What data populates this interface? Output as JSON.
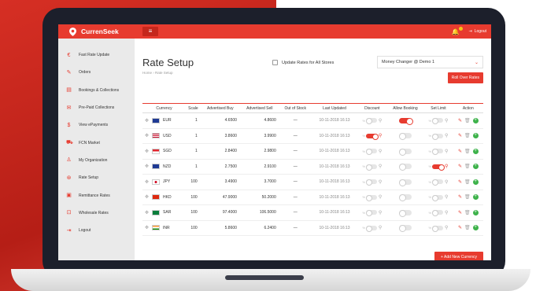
{
  "app": {
    "brand": "CurrenSeek",
    "menu_icon": "hamburger-icon",
    "logout_label": "Logout"
  },
  "sidebar": {
    "items": [
      {
        "label": "Fast Rate Update",
        "icon": "exchange-icon"
      },
      {
        "label": "Orders",
        "icon": "pencil-icon"
      },
      {
        "label": "Bookings & Collections",
        "icon": "document-icon"
      },
      {
        "label": "Pre-Paid Collections",
        "icon": "envelope-icon"
      },
      {
        "label": "View ePayments",
        "icon": "dollar-icon"
      },
      {
        "label": "FCN Market",
        "icon": "cart-icon"
      },
      {
        "label": "My Organization",
        "icon": "user-icon"
      },
      {
        "label": "Rate Setup",
        "icon": "rate-icon"
      },
      {
        "label": "Remittance Rates",
        "icon": "remittance-icon"
      },
      {
        "label": "Wholesale Rates",
        "icon": "wholesale-icon"
      },
      {
        "label": "Logout",
        "icon": "logout-icon"
      }
    ]
  },
  "page": {
    "title": "Rate Setup",
    "breadcrumb_home": "Home",
    "breadcrumb_sep": "›",
    "breadcrumb_current": "Rate Setup",
    "update_all_label": "Update Rates for All Stores",
    "store_select": "Money Changer @ Demo 1",
    "rollover_label": "Roll Over Rates",
    "add_currency_label": "+ Add New Currency"
  },
  "table": {
    "headers": [
      "Currency",
      "Scale",
      "Advertised Buy",
      "Advertised Sell",
      "Out of Stock",
      "Last Updated",
      "Discount",
      "Allow Booking",
      "Set Limit",
      "Action"
    ],
    "rows": [
      {
        "code": "EUR",
        "flag": "eu",
        "scale": "1",
        "buy": "4.6500",
        "sell": "4.8600",
        "stock": "—",
        "updated": "10-11-2018 16:13",
        "discount": false,
        "booking": true,
        "limit": false
      },
      {
        "code": "USD",
        "flag": "us",
        "scale": "1",
        "buy": "3.8600",
        "sell": "3.9900",
        "stock": "—",
        "updated": "10-11-2018 16:13",
        "discount": true,
        "booking": false,
        "limit": false
      },
      {
        "code": "SGD",
        "flag": "sg",
        "scale": "1",
        "buy": "2.8400",
        "sell": "2.9800",
        "stock": "—",
        "updated": "10-11-2018 16:13",
        "discount": false,
        "booking": false,
        "limit": false
      },
      {
        "code": "NZD",
        "flag": "nz",
        "scale": "1",
        "buy": "2.7500",
        "sell": "2.9100",
        "stock": "—",
        "updated": "10-11-2018 16:13",
        "discount": false,
        "booking": false,
        "limit": true
      },
      {
        "code": "JPY",
        "flag": "jp",
        "scale": "100",
        "buy": "3.4900",
        "sell": "3.7000",
        "stock": "—",
        "updated": "10-11-2018 16:13",
        "discount": false,
        "booking": false,
        "limit": false
      },
      {
        "code": "HKD",
        "flag": "hk",
        "scale": "100",
        "buy": "47.9000",
        "sell": "50.2000",
        "stock": "—",
        "updated": "10-11-2018 16:13",
        "discount": false,
        "booking": false,
        "limit": false
      },
      {
        "code": "SAR",
        "flag": "sa",
        "scale": "100",
        "buy": "97.4000",
        "sell": "106.5000",
        "stock": "—",
        "updated": "10-11-2018 16:13",
        "discount": false,
        "booking": false,
        "limit": false
      },
      {
        "code": "INR",
        "flag": "in",
        "scale": "100",
        "buy": "5.8600",
        "sell": "6.2400",
        "stock": "—",
        "updated": "10-11-2018 16:13",
        "discount": false,
        "booking": false,
        "limit": false
      }
    ]
  },
  "colors": {
    "accent": "#e73b2f",
    "sidebar_bg": "#eaeaea",
    "add_green": "#3db24a"
  }
}
